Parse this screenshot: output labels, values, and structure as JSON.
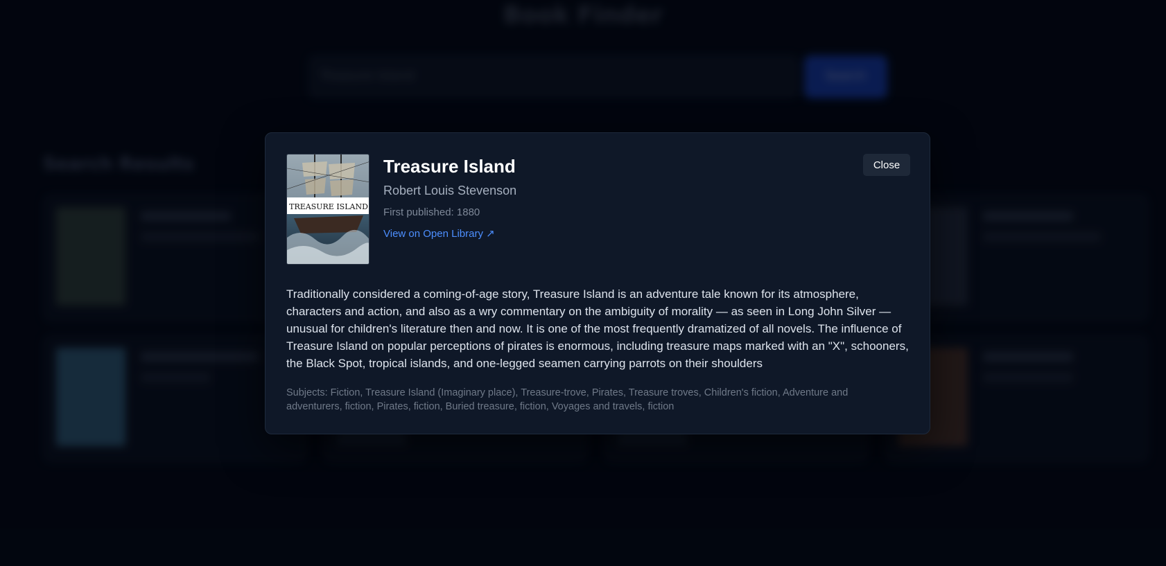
{
  "background": {
    "app_title": "Book Finder",
    "search_value": "Treasure Island",
    "search_button_label": "Search",
    "results_title": "Search Results"
  },
  "modal": {
    "title": "Treasure Island",
    "author": "Robert Louis Stevenson",
    "first_published": "First published: 1880",
    "link_label": "View on Open Library ↗",
    "close_label": "Close",
    "cover_text": "TREASURE ISLAND",
    "description": "Traditionally considered a coming-of-age story, Treasure Island is an adventure tale known for its atmosphere, characters and action, and also as a wry commentary on the ambiguity of morality — as seen in Long John Silver — unusual for children's literature then and now. It is one of the most frequently dramatized of all novels. The influence of Treasure Island on popular perceptions of pirates is enormous, including treasure maps marked with an \"X\", schooners, the Black Spot, tropical islands, and one-legged seamen carrying parrots on their shoulders",
    "subjects": "Subjects: Fiction, Treasure Island (Imaginary place), Treasure-trove, Pirates, Treasure troves, Children's fiction, Adventure and adventurers, fiction, Pirates, fiction, Buried treasure, fiction, Voyages and travels, fiction"
  },
  "colors": {
    "accent": "#4d8fff",
    "modal_bg": "#0f1828",
    "page_bg": "#02060f"
  }
}
